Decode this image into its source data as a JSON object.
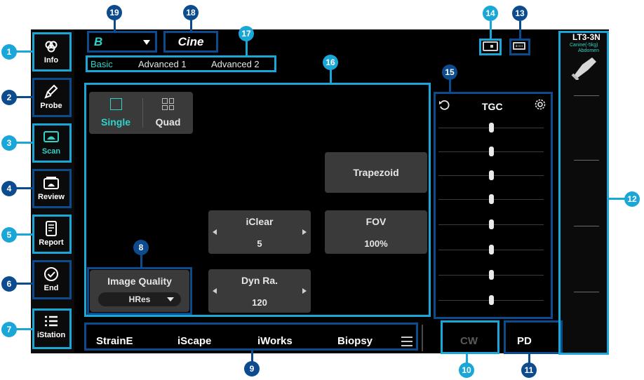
{
  "top_bar": {
    "mode_value": "B",
    "cine_label": "Cine"
  },
  "preset_tabs": [
    "Basic",
    "Advanced 1",
    "Advanced 2"
  ],
  "sidebar": {
    "items": [
      {
        "label": "Info",
        "icon": "info-icon"
      },
      {
        "label": "Probe",
        "icon": "probe-icon"
      },
      {
        "label": "Scan",
        "icon": "scan-icon"
      },
      {
        "label": "Review",
        "icon": "review-icon"
      },
      {
        "label": "Report",
        "icon": "report-icon"
      },
      {
        "label": "End",
        "icon": "end-icon"
      },
      {
        "label": "iStation",
        "icon": "istation-icon"
      }
    ],
    "active": "Scan"
  },
  "layout_toggle": {
    "single": "Single",
    "quad": "Quad"
  },
  "controls": {
    "trapezoid": "Trapezoid",
    "iclear_label": "iClear",
    "iclear_value": "5",
    "fov_label": "FOV",
    "fov_value": "100%",
    "dynra_label": "Dyn Ra.",
    "dynra_value": "120",
    "image_quality_label": "Image Quality",
    "image_quality_value": "HRes"
  },
  "tgc": {
    "title": "TGC",
    "sliders": 8
  },
  "bottom_bar": {
    "items": [
      "StrainE",
      "iScape",
      "iWorks",
      "Biopsy"
    ],
    "cw": "CW",
    "pd": "PD"
  },
  "probe": {
    "model": "LT3-3N",
    "preset_line1": "Canine(-5kg)",
    "preset_line2": "Abdomen"
  },
  "callouts": [
    "1",
    "2",
    "3",
    "4",
    "5",
    "6",
    "7",
    "8",
    "9",
    "10",
    "11",
    "12",
    "13",
    "14",
    "15",
    "16",
    "17",
    "18",
    "19"
  ],
  "colors": {
    "accent_teal": "#2fd3c9",
    "callout_light": "#1aa7d8",
    "callout_dark": "#0d4b8f",
    "button_gray": "#3a3a3a",
    "screen_bg": "#000000"
  }
}
